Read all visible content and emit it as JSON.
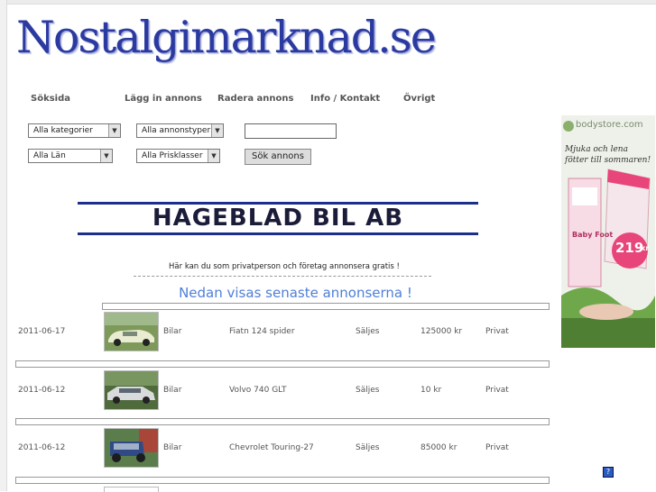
{
  "site": {
    "logo": "Nostalgimarknad.se"
  },
  "nav": [
    "Söksida",
    "Lägg in annons",
    "Radera annons",
    "Info / Kontakt",
    "Övrigt"
  ],
  "filters": {
    "category": "Alla kategorier",
    "ad_type": "Alla annonstyper",
    "region": "Alla Län",
    "price_class": "Alla Prisklasser",
    "search_value": "",
    "search_button": "Sök annons"
  },
  "banner": {
    "text": "HAGEBLAD BIL AB"
  },
  "intro": "Här kan du som privatperson och företag annonsera gratis !",
  "heading": "Nedan visas senaste annonserna !",
  "listings": [
    {
      "date": "2011-06-17",
      "category": "Bilar",
      "title": "Fiatn 124 spider",
      "type": "Säljes",
      "price": "125000 kr",
      "seller": "Privat",
      "photo": "white-classic-car"
    },
    {
      "date": "2011-06-12",
      "category": "Bilar",
      "title": "Volvo 740 GLT",
      "type": "Säljes",
      "price": "10 kr",
      "seller": "Privat",
      "photo": "silver-sedan"
    },
    {
      "date": "2011-06-12",
      "category": "Bilar",
      "title": "Chevrolet Touring-27",
      "type": "Säljes",
      "price": "85000 kr",
      "seller": "Privat",
      "photo": "vintage-blue-car"
    }
  ],
  "ad": {
    "brand": "bodystore.com",
    "slogan": "Mjuka och lena fötter till sommaren!",
    "product": "Baby Foot",
    "price": "219",
    "currency": "kr",
    "colors": {
      "pink": "#e8457a",
      "green": "#6fa84a"
    }
  },
  "help_icon": "?"
}
